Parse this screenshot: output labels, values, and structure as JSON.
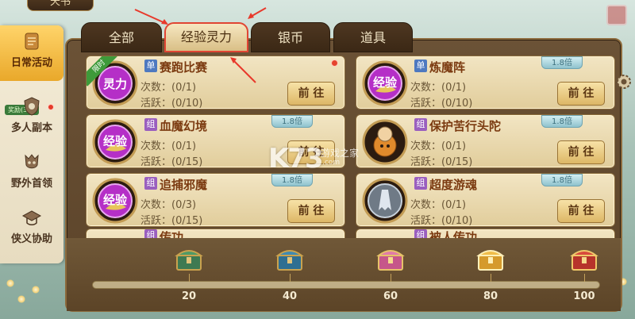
{
  "window": {
    "title": "天书"
  },
  "sidebar": {
    "items": [
      {
        "label": "日常活动",
        "icon": "scroll-icon",
        "active": true
      },
      {
        "label": "多人副本",
        "icon": "shield-icon",
        "active": false
      },
      {
        "label": "野外首领",
        "icon": "demon-mask-icon",
        "active": false
      },
      {
        "label": "侠义协助",
        "icon": "scholar-hat-icon",
        "active": false
      }
    ],
    "reward_badge": "奖励(3/3)"
  },
  "tabs": [
    {
      "label": "全部",
      "active": false
    },
    {
      "label": "经验灵力",
      "active": true
    },
    {
      "label": "银币",
      "active": false
    },
    {
      "label": "道具",
      "active": false
    }
  ],
  "cards": [
    {
      "tag": "单",
      "title": "赛跑比赛",
      "count": "次数：(0/1)",
      "activity": "活跃：(0/10)",
      "button": "前 往",
      "multiplier": "",
      "limited": "限时",
      "medal": "灵力",
      "red_dot": true
    },
    {
      "tag": "单",
      "title": "炼魔阵",
      "count": "次数：(0/1)",
      "activity": "活跃：(0/10)",
      "button": "前 往",
      "multiplier": "1.8倍",
      "limited": "",
      "medal": "经验",
      "red_dot": false
    },
    {
      "tag": "组",
      "title": "血魔幻境",
      "count": "次数：(0/1)",
      "activity": "活跃：(0/15)",
      "button": "前 往",
      "multiplier": "1.8倍",
      "limited": "",
      "medal": "经验",
      "red_dot": false
    },
    {
      "tag": "组",
      "title": "保护苦行头陀",
      "count": "次数：(0/1)",
      "activity": "活跃：(0/15)",
      "button": "前 往",
      "multiplier": "1.8倍",
      "limited": "",
      "medal": "monk",
      "red_dot": false
    },
    {
      "tag": "组",
      "title": "追捕邪魔",
      "count": "次数：(0/3)",
      "activity": "活跃：(0/15)",
      "button": "前 往",
      "multiplier": "1.8倍",
      "limited": "",
      "medal": "经验",
      "red_dot": false
    },
    {
      "tag": "组",
      "title": "超度游魂",
      "count": "次数：(0/1)",
      "activity": "活跃：(0/10)",
      "button": "前 往",
      "multiplier": "1.8倍",
      "limited": "",
      "medal": "ghost",
      "red_dot": false
    }
  ],
  "clipped_cards": [
    {
      "tag": "组",
      "title": "传功"
    },
    {
      "tag": "组",
      "title": "被人传功"
    }
  ],
  "progress": {
    "value": 0,
    "milestones": [
      {
        "value": "20",
        "chest": "green-chest-icon"
      },
      {
        "value": "40",
        "chest": "blue-chest-icon"
      },
      {
        "value": "60",
        "chest": "pink-chest-icon"
      },
      {
        "value": "80",
        "chest": "gold-chest-icon"
      },
      {
        "value": "100",
        "chest": "red-chest-icon"
      }
    ]
  },
  "watermark": {
    "logo": "K73",
    "site": "游戏之家",
    "url": ".com"
  },
  "colors": {
    "accent": "#e04533",
    "panel": "#6b5236",
    "card": "#f2e5c3",
    "tab_active": "#f6e7c1"
  }
}
